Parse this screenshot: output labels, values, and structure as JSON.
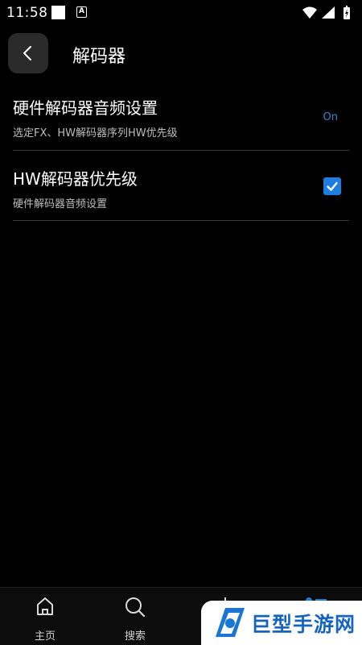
{
  "status_bar": {
    "time": "11:58",
    "notification_icons": [
      "white-square-icon",
      "a-box-icon"
    ],
    "system_icons": [
      "wifi-icon",
      "signal-icon",
      "battery-charging-icon"
    ]
  },
  "header": {
    "back_icon": "chevron-left-icon",
    "title": "解码器"
  },
  "settings": [
    {
      "title": "硬件解码器音频设置",
      "subtitle": "选定FX、HW解码器序列HW优先级",
      "value": "On"
    },
    {
      "title": "HW解码器优先级",
      "subtitle": "硬件解码器音频设置",
      "checked": true
    }
  ],
  "bottom_nav": [
    {
      "icon": "home-icon",
      "label": "主页"
    },
    {
      "icon": "search-icon",
      "label": "搜索"
    },
    {
      "icon": "download-icon",
      "label": ""
    },
    {
      "icon": "menu-icon",
      "label": ""
    }
  ],
  "watermark": {
    "text": "巨型手游网"
  },
  "colors": {
    "background": "#000000",
    "accent": "#1e7ee0",
    "value_text": "#3a86d8",
    "divider": "#3a3a3a",
    "watermark_text": "#1565c0"
  }
}
